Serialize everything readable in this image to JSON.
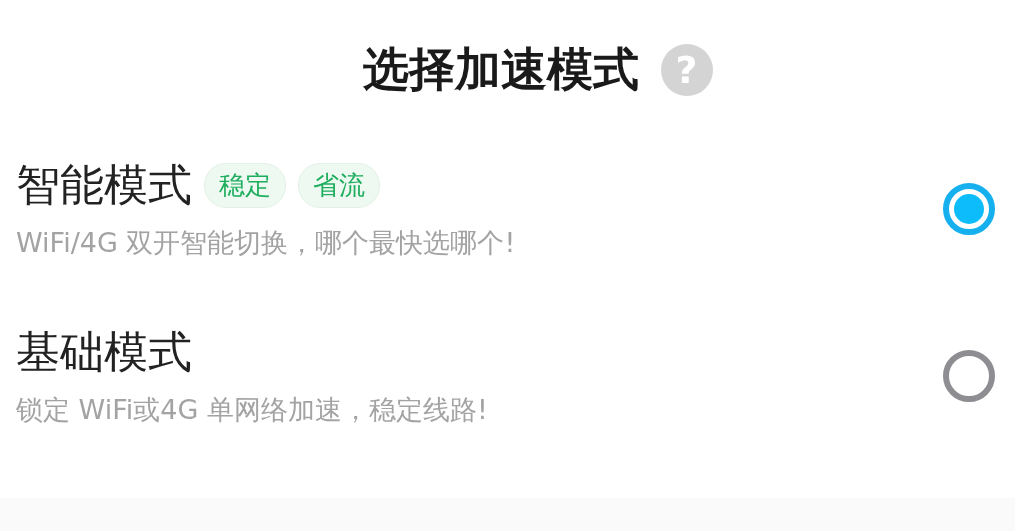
{
  "title": "选择加速模式",
  "help": "?",
  "options": [
    {
      "name": "智能模式",
      "tags": [
        "稳定",
        "省流"
      ],
      "description": "WiFi/4G 双开智能切换，哪个最快选哪个!",
      "selected": true
    },
    {
      "name": "基础模式",
      "description": "锁定 WiFi或4G 单网络加速，稳定线路!",
      "selected": false
    }
  ]
}
